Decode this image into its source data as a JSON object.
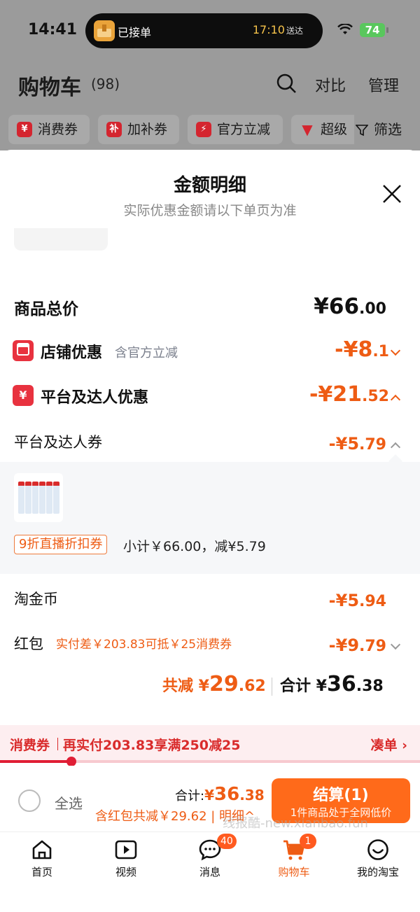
{
  "status_bar": {
    "time": "14:41",
    "island_text": "已接单",
    "island_time": "17:10",
    "island_suffix": "送达",
    "battery": "74"
  },
  "cart": {
    "title": "购物车",
    "count": "(98)",
    "compare_label": "对比",
    "manage_label": "管理"
  },
  "filters": {
    "chips": [
      {
        "icon": "¥",
        "label": "消费券"
      },
      {
        "icon": "补",
        "label": "加补券"
      },
      {
        "icon": "⚡",
        "label": "官方立减"
      },
      {
        "icon": "▼",
        "label": "超级"
      }
    ],
    "filter_label": "筛选"
  },
  "sheet": {
    "title": "金额明细",
    "subtitle": "实际优惠金额请以下单页为准",
    "total_price": {
      "label": "商品总价",
      "yen": "¥",
      "int": "66",
      "dec": ".00"
    },
    "shop_discount": {
      "label": "店铺优惠",
      "note": "含官方立减",
      "prefix": "-¥",
      "int": "8",
      "dec": ".1"
    },
    "platform_discount": {
      "label": "平台及达人优惠",
      "prefix": "-¥",
      "int": "21",
      "dec": ".52"
    },
    "coupon": {
      "label": "平台及达人券",
      "prefix": "-¥",
      "int": "5",
      "dec": ".79"
    },
    "coupon_detail": {
      "tag": "9折直播折扣券",
      "info": "小计￥66.00，减¥5.79"
    },
    "taojin": {
      "label": "淘金币",
      "prefix": "-¥",
      "int": "5",
      "dec": ".94"
    },
    "red_packet": {
      "label": "红包",
      "note": "实付差￥203.83可抵￥25消费券",
      "prefix": "-¥",
      "int": "9",
      "dec": ".79"
    },
    "summary": {
      "reduce_label": "共减 ¥",
      "reduce_int": "29",
      "reduce_dec": ".62",
      "total_label": "合计 ¥",
      "total_int": "36",
      "total_dec": ".38"
    }
  },
  "promo": {
    "tag": "消费券",
    "text": "再实付203.83享满250减25",
    "link": "凑单 ›",
    "progress": 0.17
  },
  "checkout": {
    "select_all": "全选",
    "total_label": "合计:",
    "total_yen": "¥",
    "total_int": "36",
    "total_dec": ".38",
    "sub": "含红包共减￥29.62 | 明细^",
    "button_main": "结算(1)",
    "button_sub": "1件商品处于全网低价"
  },
  "watermark": "线报酷-new.xianbao.fun",
  "tabs": [
    {
      "label": "首页",
      "icon": "home-icon"
    },
    {
      "label": "视频",
      "icon": "video-icon"
    },
    {
      "label": "消息",
      "icon": "message-icon",
      "badge": "40"
    },
    {
      "label": "购物车",
      "icon": "cart-icon",
      "badge": "1",
      "active": true
    },
    {
      "label": "我的淘宝",
      "icon": "profile-icon"
    }
  ],
  "colors": {
    "accent": "#ee5c14",
    "danger": "#d92b2b",
    "checkout_button": "#ff6a1a"
  }
}
